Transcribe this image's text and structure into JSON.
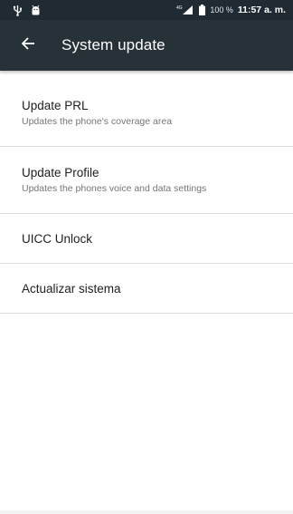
{
  "status_bar": {
    "icons": [
      "usb-icon",
      "android-debug-icon",
      "signal-icon",
      "battery-icon"
    ],
    "network_label": "4G",
    "battery_percent": "100 %",
    "time": "11:57 a. m."
  },
  "toolbar": {
    "back_icon": "arrow-back-icon",
    "title": "System update",
    "background_color": "#263238"
  },
  "list": {
    "items": [
      {
        "title": "Update PRL",
        "subtitle": "Updates the phone's coverage area"
      },
      {
        "title": "Update Profile",
        "subtitle": "Updates the phones voice and data settings"
      },
      {
        "title": "UICC Unlock"
      },
      {
        "title": "Actualizar sistema"
      }
    ]
  }
}
